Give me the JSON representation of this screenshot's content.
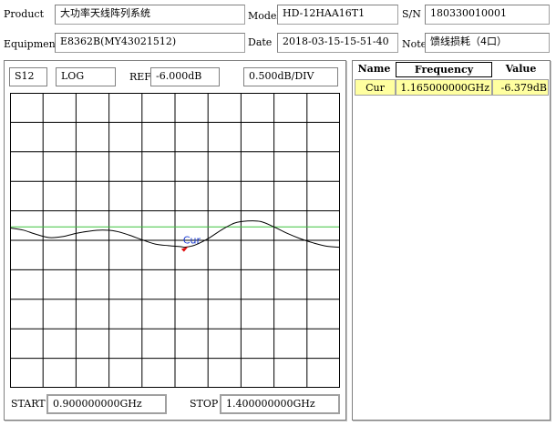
{
  "info": {
    "product_label": "Product",
    "product_value": "大功率天线阵列系统",
    "model_label": "Model",
    "model_value": "HD-12HAA16T1",
    "sn_label": "S/N",
    "sn_value": "180330010001",
    "equipment_label": "Equipment",
    "equipment_value": "E8362B(MY43021512)",
    "date_label": "Date",
    "date_value": "2018-03-15-15-51-40",
    "note_label": "Note",
    "note_value": "馈线损耗（4口）"
  },
  "plot": {
    "param": "S12",
    "format": "LOG",
    "ref_label": "REF",
    "ref_value": "-6.000dB",
    "scale_value": "0.500dB/DIV",
    "start_label": "START",
    "start_value": "0.900000000GHz",
    "stop_label": "STOP",
    "stop_value": "1.400000000GHz",
    "marker_label": "Cur"
  },
  "markers": {
    "headers": {
      "name": "Name",
      "frequency": "Frequency",
      "value": "Value"
    },
    "rows": [
      {
        "name": "Cur",
        "frequency": "1.165000000GHz",
        "value": "-6.379dB"
      }
    ]
  },
  "chart_data": {
    "type": "line",
    "xlim": [
      0.9,
      1.4
    ],
    "ylim": [
      -9.0,
      -3.5
    ],
    "reference_line": -6.0,
    "grid": true,
    "series": [
      {
        "x": [
          0.9,
          0.92,
          0.94,
          0.96,
          0.98,
          1.0,
          1.02,
          1.04,
          1.06,
          1.08,
          1.1,
          1.12,
          1.14,
          1.16,
          1.165,
          1.18,
          1.2,
          1.22,
          1.24,
          1.26,
          1.28,
          1.3,
          1.32,
          1.34,
          1.36,
          1.38,
          1.4
        ],
        "y": [
          -6.02,
          -6.06,
          -6.14,
          -6.2,
          -6.18,
          -6.12,
          -6.08,
          -6.06,
          -6.08,
          -6.15,
          -6.24,
          -6.32,
          -6.35,
          -6.37,
          -6.379,
          -6.34,
          -6.22,
          -6.06,
          -5.93,
          -5.89,
          -5.9,
          -6.0,
          -6.12,
          -6.22,
          -6.3,
          -6.36,
          -6.38
        ]
      }
    ]
  }
}
